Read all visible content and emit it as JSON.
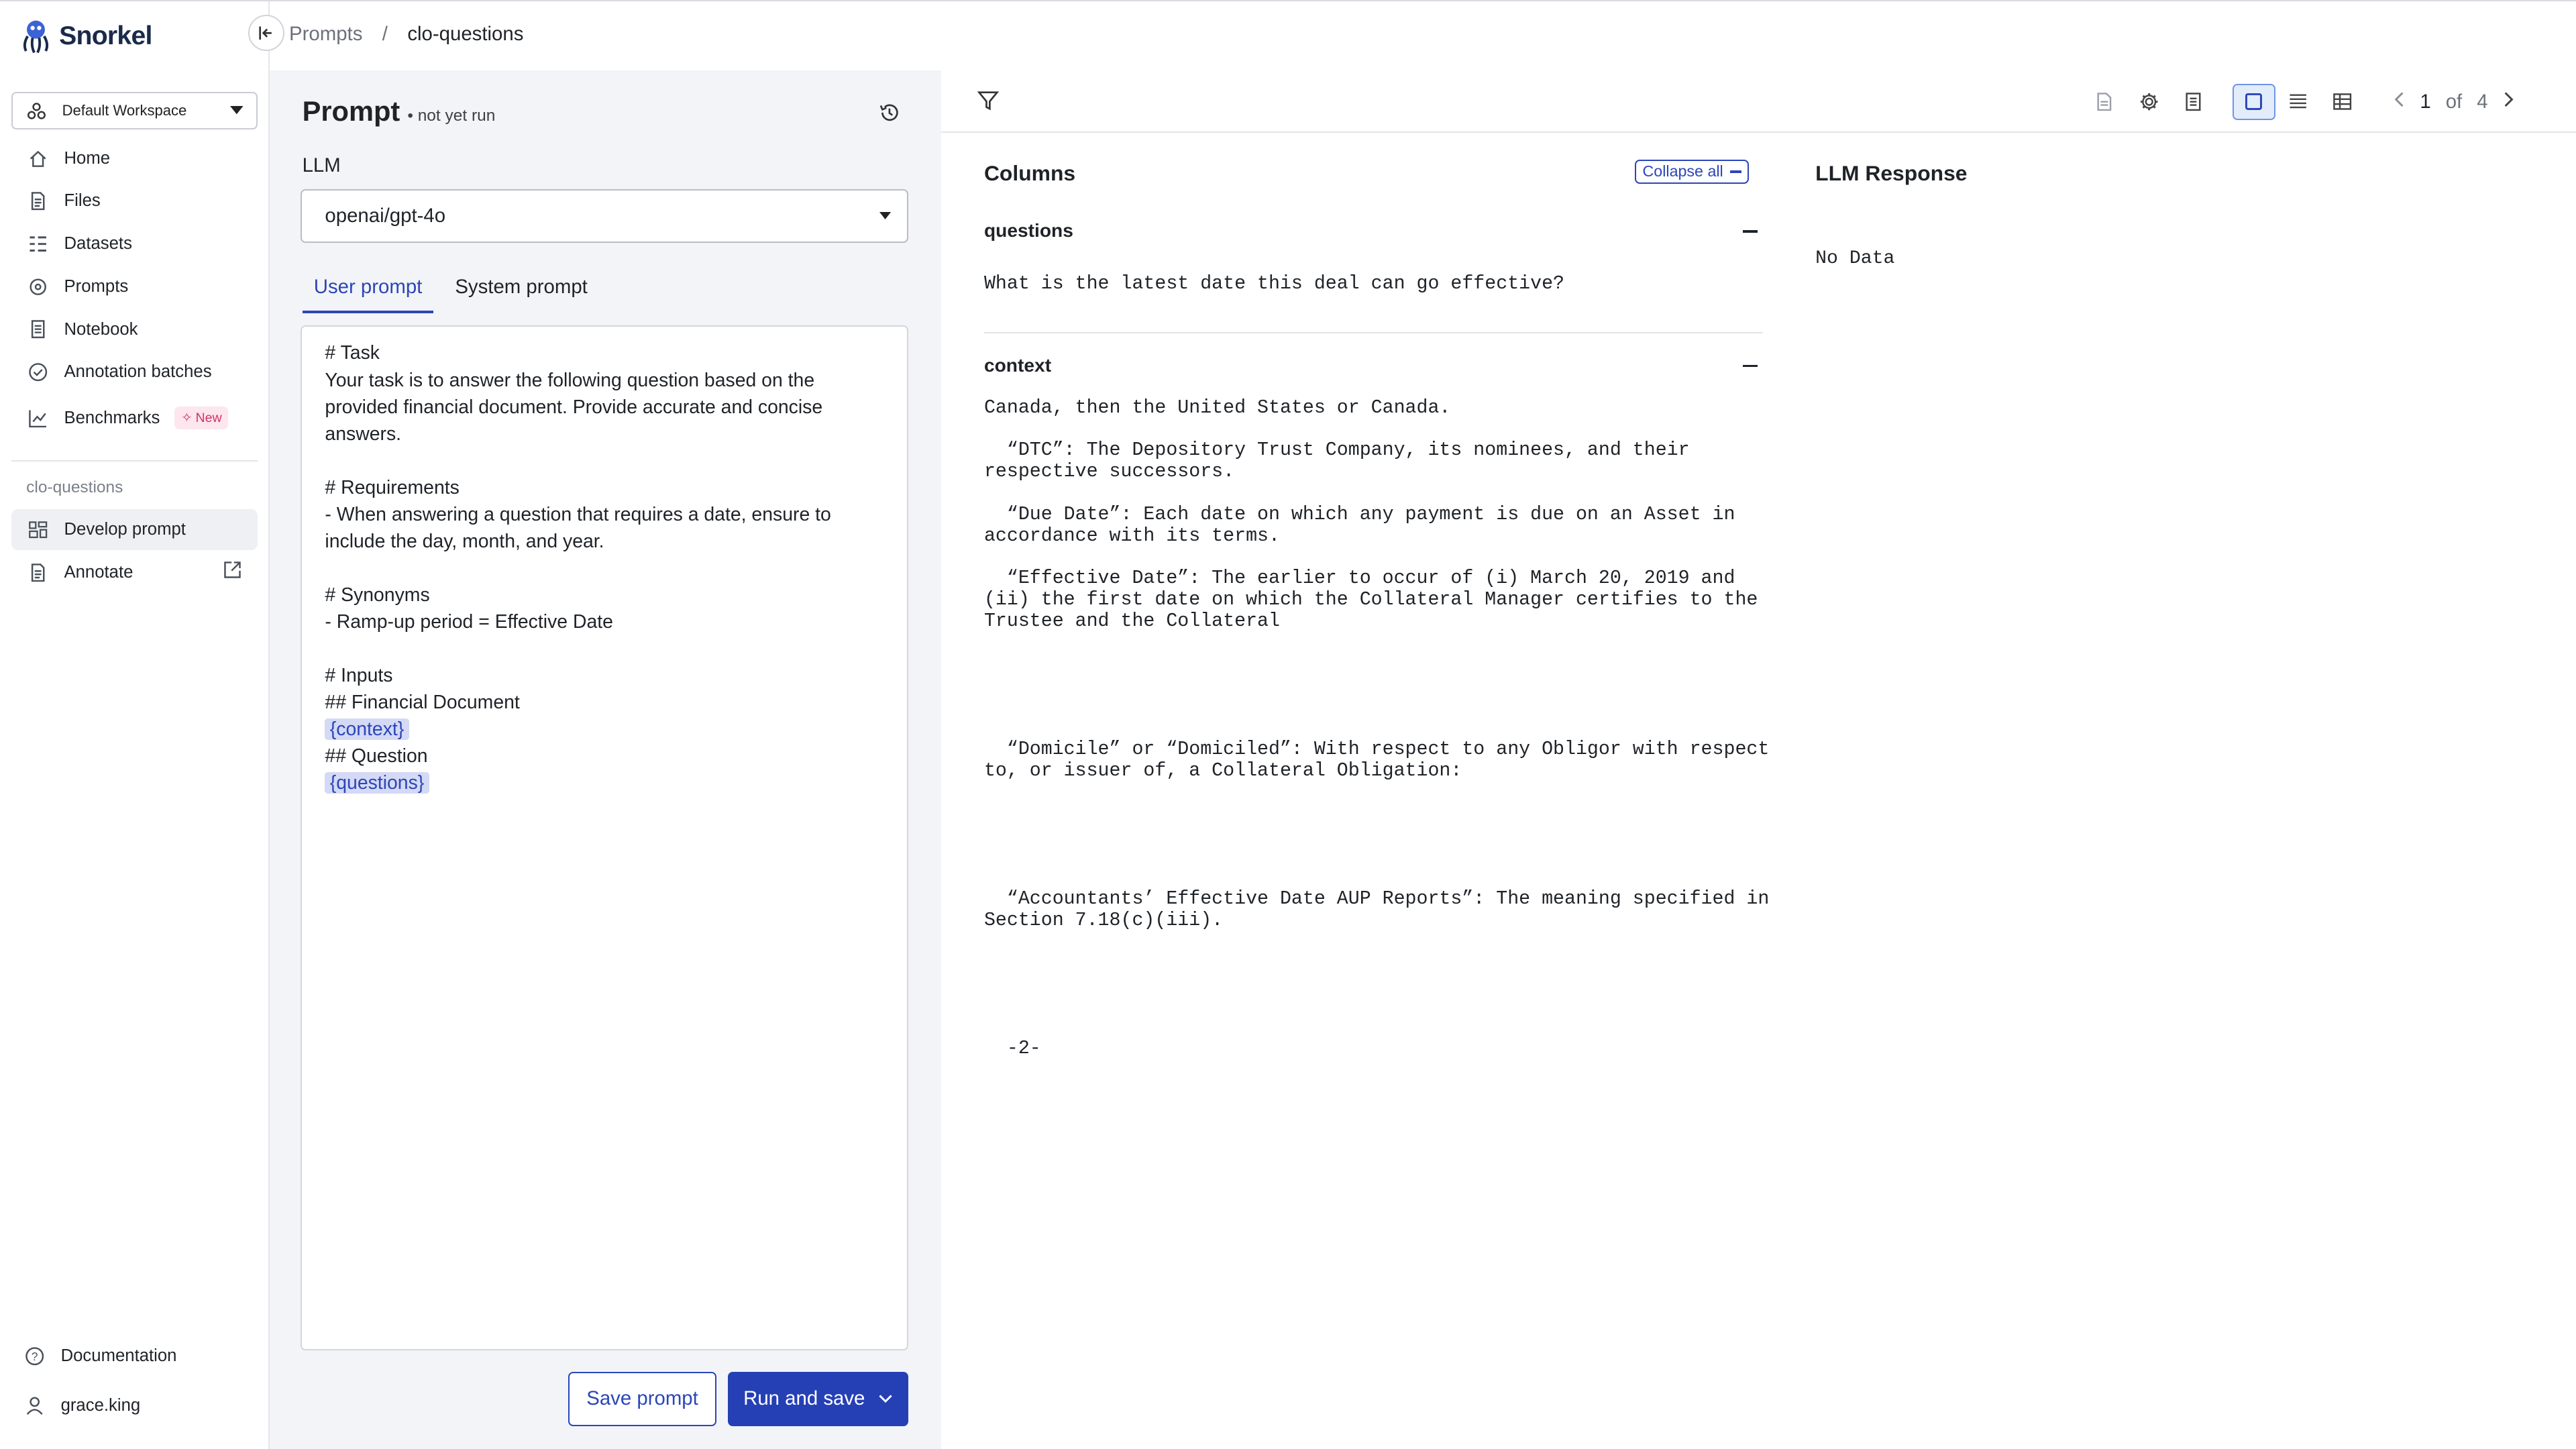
{
  "app": {
    "name": "Snorkel",
    "workspace": "Default Workspace"
  },
  "breadcrumb": {
    "parent": "Prompts",
    "separator": "/",
    "current": "clo-questions"
  },
  "sidebar": {
    "nav": [
      {
        "label": "Home",
        "icon": "home-icon"
      },
      {
        "label": "Files",
        "icon": "file-icon"
      },
      {
        "label": "Datasets",
        "icon": "datasets-icon"
      },
      {
        "label": "Prompts",
        "icon": "prompts-icon"
      },
      {
        "label": "Notebook",
        "icon": "notebook-icon"
      },
      {
        "label": "Annotation batches",
        "icon": "check-circle-icon"
      },
      {
        "label": "Benchmarks",
        "icon": "chart-icon",
        "badge": "New"
      }
    ],
    "section_label": "clo-questions",
    "section_items": [
      {
        "label": "Develop prompt",
        "icon": "develop-icon",
        "active": true
      },
      {
        "label": "Annotate",
        "icon": "file-icon",
        "external": true
      }
    ],
    "footer": {
      "documentation": "Documentation",
      "user": "grace.king"
    }
  },
  "prompt": {
    "title": "Prompt",
    "status": "• not yet run",
    "llm_label": "LLM",
    "llm_value": "openai/gpt-4o",
    "tabs": [
      "User prompt",
      "System prompt"
    ],
    "active_tab": "User prompt",
    "lines": [
      {
        "text": "# Task"
      },
      {
        "text": "Your task is to answer the following question based on the"
      },
      {
        "text": "provided financial document. Provide accurate and concise"
      },
      {
        "text": "answers."
      },
      {
        "text": ""
      },
      {
        "text": "# Requirements"
      },
      {
        "text": "- When answering a question that requires a date, ensure to"
      },
      {
        "text": "include the day, month, and year."
      },
      {
        "text": ""
      },
      {
        "text": "# Synonyms"
      },
      {
        "text": "- Ramp-up period = Effective Date"
      },
      {
        "text": ""
      },
      {
        "text": "# Inputs"
      },
      {
        "text": "## Financial Document"
      },
      {
        "text": "{context}",
        "variable": true
      },
      {
        "text": "## Question"
      },
      {
        "text": "{questions}",
        "variable": true
      }
    ],
    "save_label": "Save prompt",
    "run_label": "Run and save"
  },
  "toolbar": {
    "page_current": "1",
    "page_of": "of",
    "page_total": "4"
  },
  "columns": {
    "title": "Columns",
    "collapse_all": "Collapse all",
    "fields": [
      {
        "name": "questions",
        "value_lines": [
          "What is the latest date this deal can go effective?"
        ]
      },
      {
        "name": "context",
        "value_lines": [
          "Canada, then the United States or Canada.",
          "",
          "  “DTC”: The Depository Trust Company, its nominees, and their",
          "respective successors.",
          "",
          "  “Due Date”: Each date on which any payment is due on an Asset in",
          "accordance with its terms.",
          "",
          "  “Effective Date”: The earlier to occur of (i) March 20, 2019 and",
          "(ii) the first date on which the Collateral Manager certifies to the",
          "Trustee and the Collateral",
          "",
          "",
          "",
          "",
          "",
          "  “Domicile” or “Domiciled”: With respect to any Obligor with respect",
          "to, or issuer of, a Collateral Obligation:",
          "",
          "",
          "",
          "",
          "",
          "  “Accountants’ Effective Date AUP Reports”: The meaning specified in",
          "Section 7.18(c)(iii).",
          "",
          "",
          "",
          "",
          "",
          "  -2-"
        ]
      }
    ]
  },
  "llm_response": {
    "title": "LLM Response",
    "value": "No Data"
  },
  "colors": {
    "accent": "#2540b5",
    "variable_bg": "#d4d9f5",
    "badge_bg": "#fde6ee",
    "badge_text": "#d2336b"
  }
}
